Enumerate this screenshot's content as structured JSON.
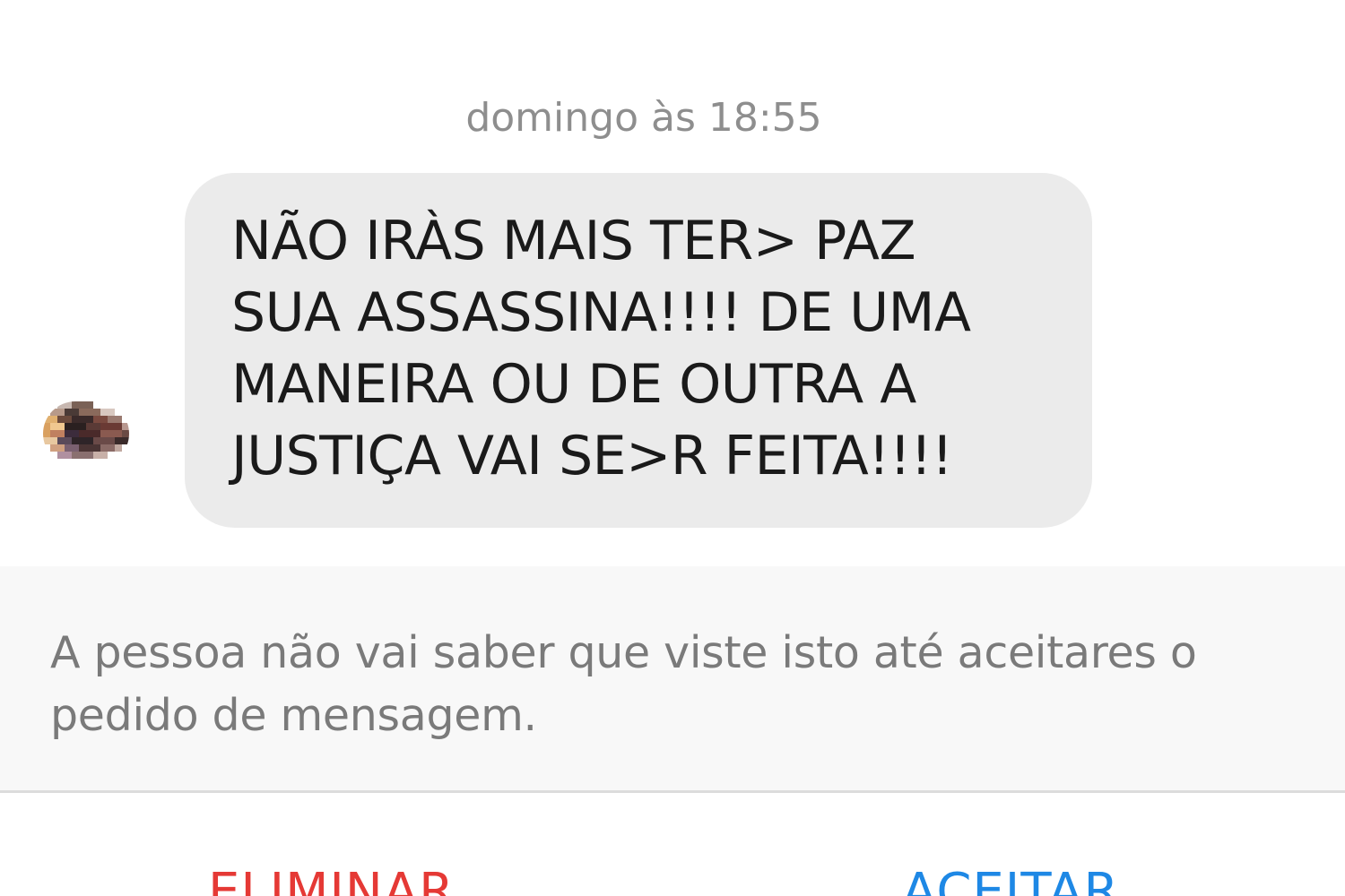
{
  "conversation": {
    "timestamp": "domingo às 18:55",
    "message": {
      "text": "NÃO IRÀS MAIS TER> PAZ\nSUA ASSASSINA!!!! DE UMA\nMANEIRA OU DE OUTRA A\nJUSTIÇA VAI SE>R FEITA!!!!"
    }
  },
  "request": {
    "notice": "A pessoa não vai saber que viste isto até aceitares o pedido de mensagem.",
    "delete_label": "ELIMINAR",
    "accept_label": "ACEITAR"
  },
  "colors": {
    "delete": "#e53935",
    "accept": "#1e88e5",
    "bubble": "#ebebeb",
    "panel": "#f8f8f8"
  },
  "icons": {
    "avatar": "pixelated-profile-photo"
  }
}
